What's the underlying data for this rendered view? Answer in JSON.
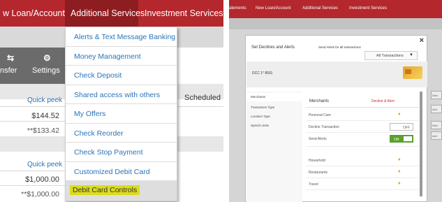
{
  "left": {
    "nav_tabs": [
      "w Loan/Account",
      "Additional Services",
      "Investment Services"
    ],
    "tools": [
      {
        "icon": "transfer-icon",
        "label": "nsfer"
      },
      {
        "icon": "gear-icon",
        "label": "Settings"
      }
    ],
    "scheduled_label": "Scheduled",
    "accounts": [
      {
        "quick_peek": "Quick peek",
        "balance": "$144.52",
        "available": "**$133.42"
      },
      {
        "quick_peek": "Quick peek",
        "balance": "$1,000.00",
        "available": "**$1,000.00"
      }
    ],
    "menu": [
      "Alerts & Text Message Banking",
      "Money Management",
      "Check Deposit",
      "Shared access with others",
      "My Offers",
      "Check Reorder",
      "Check Stop Payment",
      "Customized Debit Card",
      "Debit Card Controls"
    ]
  },
  "right": {
    "nav": [
      "atements",
      "New Loan/Account",
      "Additional Services",
      "Investment Services"
    ],
    "modal": {
      "close": "×",
      "title": "Set Declines and Alerts",
      "send_alerts": "Send Alerts for all transactions",
      "select_value": "All Transactions",
      "card_label": "DCC 1* 8591",
      "sidebar": [
        "Merchants",
        "Transaction Type",
        "Location Type",
        "Spend Limits"
      ],
      "merchants_header": "Merchants",
      "decline_alert": "Decline & Alert",
      "rows": [
        {
          "label": "Personal Care",
          "control": "bell"
        },
        {
          "label": "Decline Transaction",
          "control": "off",
          "toggle": "OFF"
        },
        {
          "label": "Send Alerts",
          "control": "on",
          "toggle": "ON"
        },
        {
          "label": "Household",
          "control": "bell"
        },
        {
          "label": "Restaurants",
          "control": "bell"
        },
        {
          "label": "Travel",
          "control": "bell"
        }
      ]
    },
    "side_stubs": [
      "Decl",
      "Acti",
      "Decl",
      "Acti"
    ]
  },
  "colors": {
    "brand_red": "#b3272d",
    "link_blue": "#2b73b8",
    "highlight": "#dcdc1e",
    "toggle_green": "#5aa02c"
  }
}
